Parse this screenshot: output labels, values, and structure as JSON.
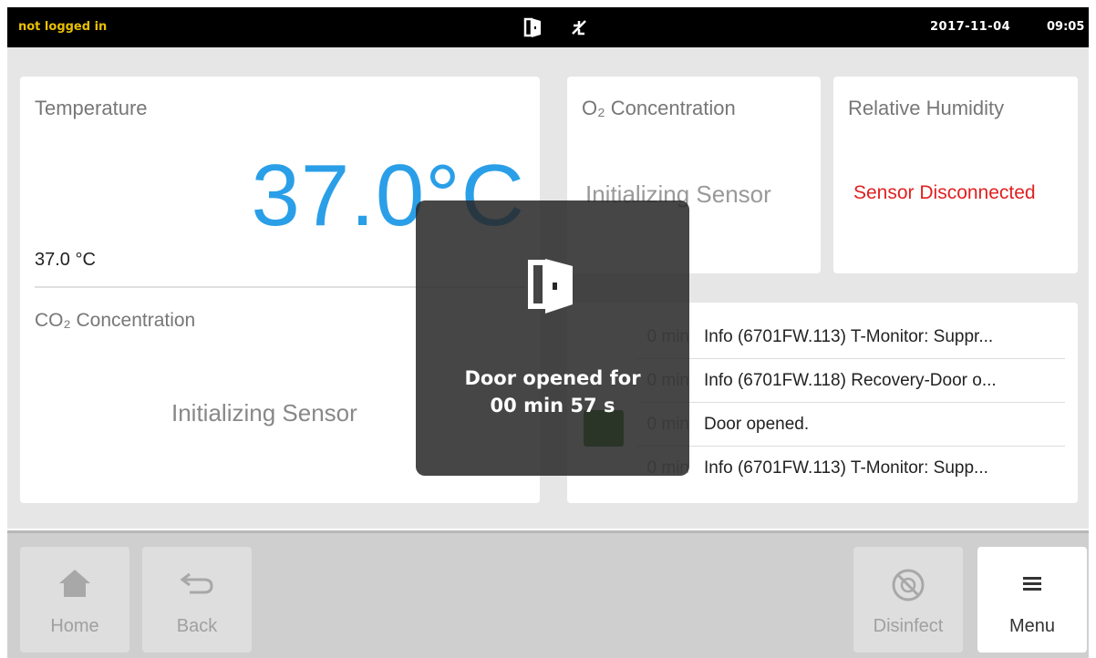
{
  "status": {
    "login_text": "not logged in",
    "date": "2017-11-04",
    "time": "09:05",
    "icons": [
      "door-open-icon",
      "no-connection-icon"
    ],
    "colors": {
      "login": "#e8c000"
    }
  },
  "temperature": {
    "title": "Temperature",
    "value": "37.0°C",
    "setpoint": "37.0 °C",
    "color": "#2a9fe8"
  },
  "co2": {
    "title": "CO₂ Concentration",
    "status": "Initializing Sensor"
  },
  "o2": {
    "title": "O₂ Concentration",
    "status": "Initializing Sensor"
  },
  "humidity": {
    "title": "Relative Humidity",
    "status": "Sensor Disconnected",
    "color": "#e02020"
  },
  "log": {
    "entries": [
      {
        "time": "0 min",
        "message": "Info (6701FW.113)  T-Monitor: Suppr..."
      },
      {
        "time": "0 min",
        "message": "Info (6701FW.118)  Recovery-Door o..."
      },
      {
        "time": "0 min",
        "message": "Door opened."
      },
      {
        "time": "0 min",
        "message": "Info (6701FW.113)  T-Monitor: Supp..."
      }
    ]
  },
  "overlay": {
    "line1": "Door opened for",
    "line2": "00 min 57 s",
    "icon": "door-open-icon"
  },
  "nav": {
    "home": "Home",
    "back": "Back",
    "disinfect": "Disinfect",
    "menu": "Menu"
  }
}
